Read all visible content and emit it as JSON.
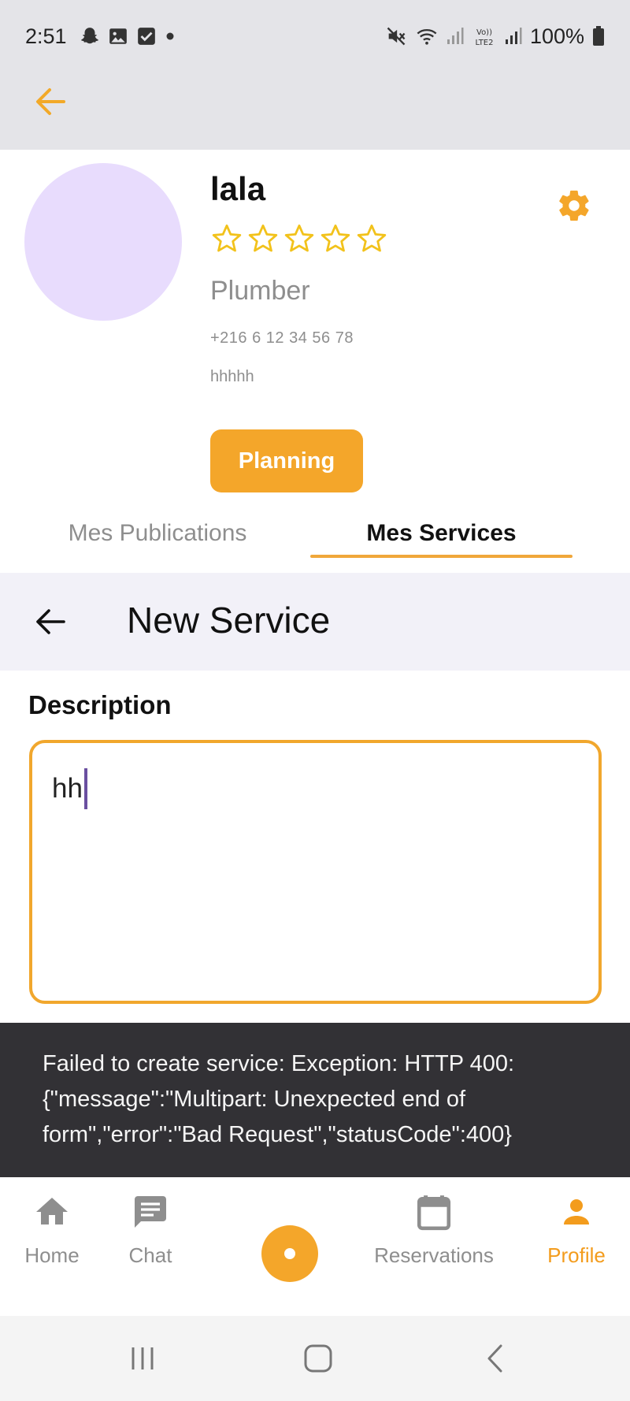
{
  "status_bar": {
    "time": "2:51",
    "battery": "100%",
    "left_icons": [
      "snapchat-icon",
      "gallery-icon",
      "checkbox-icon",
      "dot-icon"
    ],
    "right_icons": [
      "mute-icon",
      "wifi-icon",
      "signal-icon",
      "volte-icon",
      "signal-icon",
      "battery-icon"
    ]
  },
  "profile": {
    "name": "lala",
    "rating": 0,
    "rating_max": 5,
    "role": "Plumber",
    "phone": "+216 6 12 34 56 78",
    "bio": "hhhhh",
    "planning_label": "Planning"
  },
  "tabs": [
    {
      "label": "Mes Publications",
      "active": false
    },
    {
      "label": "Mes Services",
      "active": true
    }
  ],
  "new_service": {
    "title": "New Service",
    "description_label": "Description",
    "description_value": "hh"
  },
  "snackbar": {
    "message": "Failed to create service: Exception: HTTP 400: {\"message\":\"Multipart: Unexpected end of form\",\"error\":\"Bad Request\",\"statusCode\":400}"
  },
  "bottom_nav": {
    "items": [
      {
        "label": "Home",
        "icon": "home-icon",
        "active": false
      },
      {
        "label": "Chat",
        "icon": "chat-icon",
        "active": false
      },
      {
        "label": "Reservations",
        "icon": "calendar-icon",
        "active": false
      },
      {
        "label": "Profile",
        "icon": "person-icon",
        "active": true
      }
    ]
  },
  "colors": {
    "accent": "#f4a62a",
    "avatar": "#e8dcfd",
    "snackbar": "#323135",
    "muted_text": "#8e8e8e"
  }
}
